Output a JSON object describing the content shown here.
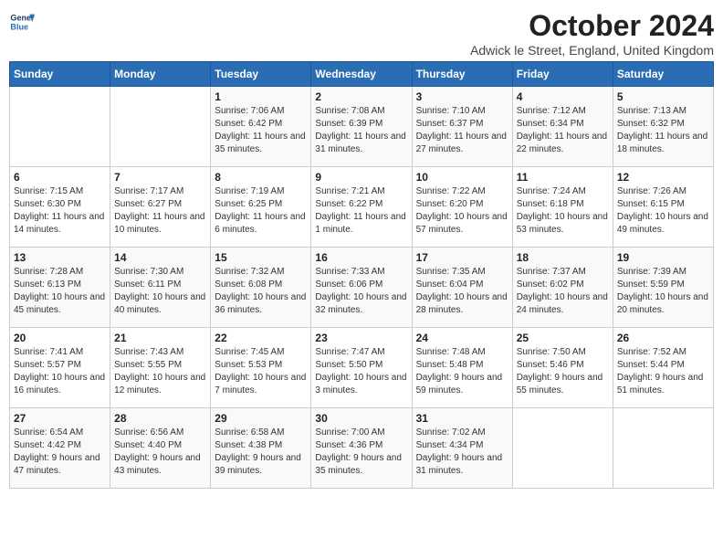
{
  "logo": {
    "line1": "General",
    "line2": "Blue"
  },
  "title": "October 2024",
  "location": "Adwick le Street, England, United Kingdom",
  "days_header": [
    "Sunday",
    "Monday",
    "Tuesday",
    "Wednesday",
    "Thursday",
    "Friday",
    "Saturday"
  ],
  "weeks": [
    [
      {
        "num": "",
        "info": ""
      },
      {
        "num": "",
        "info": ""
      },
      {
        "num": "1",
        "info": "Sunrise: 7:06 AM\nSunset: 6:42 PM\nDaylight: 11 hours and 35 minutes."
      },
      {
        "num": "2",
        "info": "Sunrise: 7:08 AM\nSunset: 6:39 PM\nDaylight: 11 hours and 31 minutes."
      },
      {
        "num": "3",
        "info": "Sunrise: 7:10 AM\nSunset: 6:37 PM\nDaylight: 11 hours and 27 minutes."
      },
      {
        "num": "4",
        "info": "Sunrise: 7:12 AM\nSunset: 6:34 PM\nDaylight: 11 hours and 22 minutes."
      },
      {
        "num": "5",
        "info": "Sunrise: 7:13 AM\nSunset: 6:32 PM\nDaylight: 11 hours and 18 minutes."
      }
    ],
    [
      {
        "num": "6",
        "info": "Sunrise: 7:15 AM\nSunset: 6:30 PM\nDaylight: 11 hours and 14 minutes."
      },
      {
        "num": "7",
        "info": "Sunrise: 7:17 AM\nSunset: 6:27 PM\nDaylight: 11 hours and 10 minutes."
      },
      {
        "num": "8",
        "info": "Sunrise: 7:19 AM\nSunset: 6:25 PM\nDaylight: 11 hours and 6 minutes."
      },
      {
        "num": "9",
        "info": "Sunrise: 7:21 AM\nSunset: 6:22 PM\nDaylight: 11 hours and 1 minute."
      },
      {
        "num": "10",
        "info": "Sunrise: 7:22 AM\nSunset: 6:20 PM\nDaylight: 10 hours and 57 minutes."
      },
      {
        "num": "11",
        "info": "Sunrise: 7:24 AM\nSunset: 6:18 PM\nDaylight: 10 hours and 53 minutes."
      },
      {
        "num": "12",
        "info": "Sunrise: 7:26 AM\nSunset: 6:15 PM\nDaylight: 10 hours and 49 minutes."
      }
    ],
    [
      {
        "num": "13",
        "info": "Sunrise: 7:28 AM\nSunset: 6:13 PM\nDaylight: 10 hours and 45 minutes."
      },
      {
        "num": "14",
        "info": "Sunrise: 7:30 AM\nSunset: 6:11 PM\nDaylight: 10 hours and 40 minutes."
      },
      {
        "num": "15",
        "info": "Sunrise: 7:32 AM\nSunset: 6:08 PM\nDaylight: 10 hours and 36 minutes."
      },
      {
        "num": "16",
        "info": "Sunrise: 7:33 AM\nSunset: 6:06 PM\nDaylight: 10 hours and 32 minutes."
      },
      {
        "num": "17",
        "info": "Sunrise: 7:35 AM\nSunset: 6:04 PM\nDaylight: 10 hours and 28 minutes."
      },
      {
        "num": "18",
        "info": "Sunrise: 7:37 AM\nSunset: 6:02 PM\nDaylight: 10 hours and 24 minutes."
      },
      {
        "num": "19",
        "info": "Sunrise: 7:39 AM\nSunset: 5:59 PM\nDaylight: 10 hours and 20 minutes."
      }
    ],
    [
      {
        "num": "20",
        "info": "Sunrise: 7:41 AM\nSunset: 5:57 PM\nDaylight: 10 hours and 16 minutes."
      },
      {
        "num": "21",
        "info": "Sunrise: 7:43 AM\nSunset: 5:55 PM\nDaylight: 10 hours and 12 minutes."
      },
      {
        "num": "22",
        "info": "Sunrise: 7:45 AM\nSunset: 5:53 PM\nDaylight: 10 hours and 7 minutes."
      },
      {
        "num": "23",
        "info": "Sunrise: 7:47 AM\nSunset: 5:50 PM\nDaylight: 10 hours and 3 minutes."
      },
      {
        "num": "24",
        "info": "Sunrise: 7:48 AM\nSunset: 5:48 PM\nDaylight: 9 hours and 59 minutes."
      },
      {
        "num": "25",
        "info": "Sunrise: 7:50 AM\nSunset: 5:46 PM\nDaylight: 9 hours and 55 minutes."
      },
      {
        "num": "26",
        "info": "Sunrise: 7:52 AM\nSunset: 5:44 PM\nDaylight: 9 hours and 51 minutes."
      }
    ],
    [
      {
        "num": "27",
        "info": "Sunrise: 6:54 AM\nSunset: 4:42 PM\nDaylight: 9 hours and 47 minutes."
      },
      {
        "num": "28",
        "info": "Sunrise: 6:56 AM\nSunset: 4:40 PM\nDaylight: 9 hours and 43 minutes."
      },
      {
        "num": "29",
        "info": "Sunrise: 6:58 AM\nSunset: 4:38 PM\nDaylight: 9 hours and 39 minutes."
      },
      {
        "num": "30",
        "info": "Sunrise: 7:00 AM\nSunset: 4:36 PM\nDaylight: 9 hours and 35 minutes."
      },
      {
        "num": "31",
        "info": "Sunrise: 7:02 AM\nSunset: 4:34 PM\nDaylight: 9 hours and 31 minutes."
      },
      {
        "num": "",
        "info": ""
      },
      {
        "num": "",
        "info": ""
      }
    ]
  ]
}
